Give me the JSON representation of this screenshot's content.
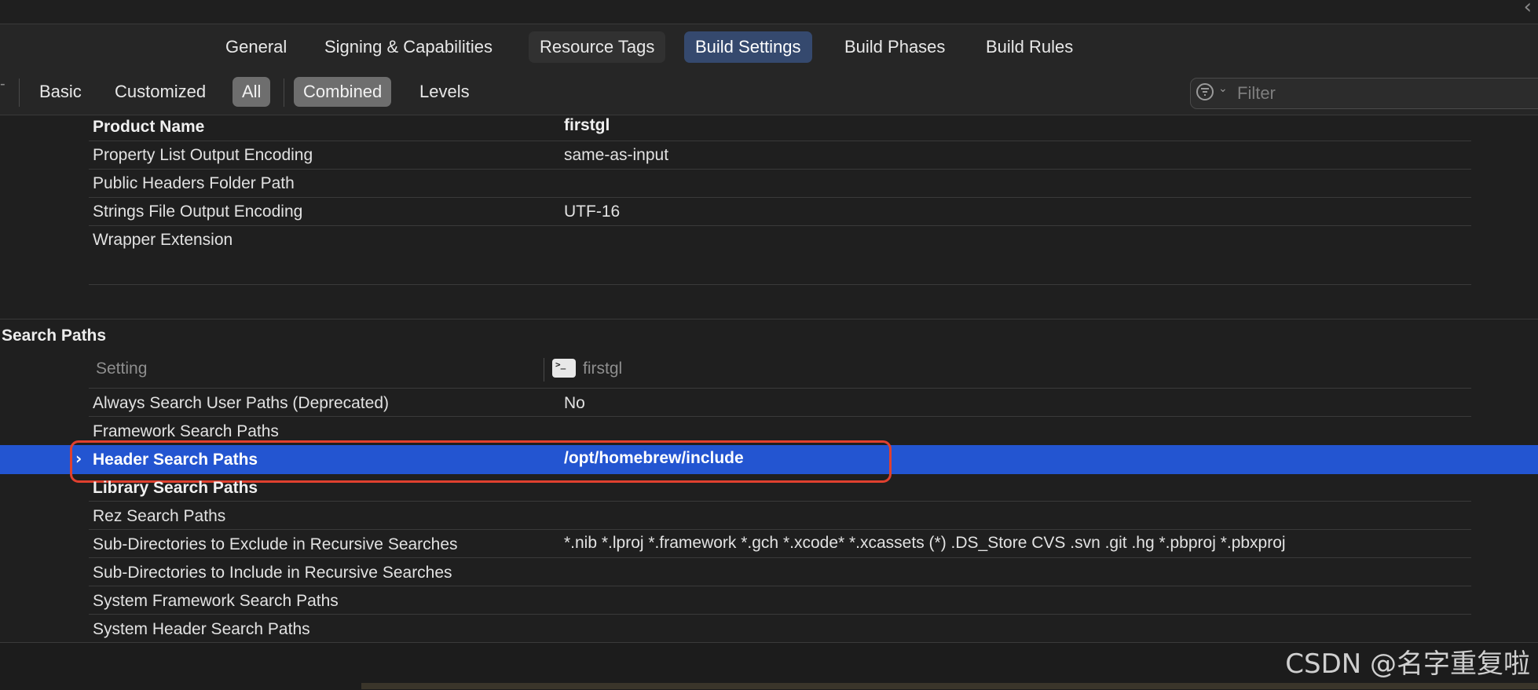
{
  "tabs": [
    {
      "label": "General"
    },
    {
      "label": "Signing & Capabilities"
    },
    {
      "label": "Resource Tags"
    },
    {
      "label": "Build Settings"
    },
    {
      "label": "Build Phases"
    },
    {
      "label": "Build Rules"
    }
  ],
  "filter_bar": {
    "segments": [
      {
        "label": "Basic"
      },
      {
        "label": "Customized"
      },
      {
        "label": "All"
      },
      {
        "label": "Combined"
      },
      {
        "label": "Levels"
      }
    ],
    "filter_placeholder": "Filter"
  },
  "packaging_rows": [
    {
      "label": "Product Name",
      "value": "firstgl"
    },
    {
      "label": "Property List Output Encoding",
      "value": "same-as-input"
    },
    {
      "label": "Public Headers Folder Path",
      "value": ""
    },
    {
      "label": "Strings File Output Encoding",
      "value": "UTF-16"
    },
    {
      "label": "Wrapper Extension",
      "value": ""
    }
  ],
  "search_paths": {
    "title": "Search Paths",
    "header_setting": "Setting",
    "header_target": "firstgl",
    "terminal_glyph": ">_",
    "rows": [
      {
        "label": "Always Search User Paths (Deprecated)",
        "value": "No"
      },
      {
        "label": "Framework Search Paths",
        "value": ""
      },
      {
        "label": "Header Search Paths",
        "value": "/opt/homebrew/include"
      },
      {
        "label": "Library Search Paths",
        "value": ""
      },
      {
        "label": "Rez Search Paths",
        "value": ""
      },
      {
        "label": "Sub-Directories to Exclude in Recursive Searches",
        "value": "*.nib *.lproj *.framework *.gch *.xcode* *.xcassets (*) .DS_Store CVS .svn .git .hg *.pbproj *.pbxproj"
      },
      {
        "label": "Sub-Directories to Include in Recursive Searches",
        "value": ""
      },
      {
        "label": "System Framework Search Paths",
        "value": ""
      },
      {
        "label": "System Header Search Paths",
        "value": ""
      }
    ]
  },
  "watermark": "CSDN @名字重复啦",
  "colors": {
    "selection": "#2355d1",
    "highlight_outline": "#e0402f",
    "active_tab": "#35496e"
  }
}
